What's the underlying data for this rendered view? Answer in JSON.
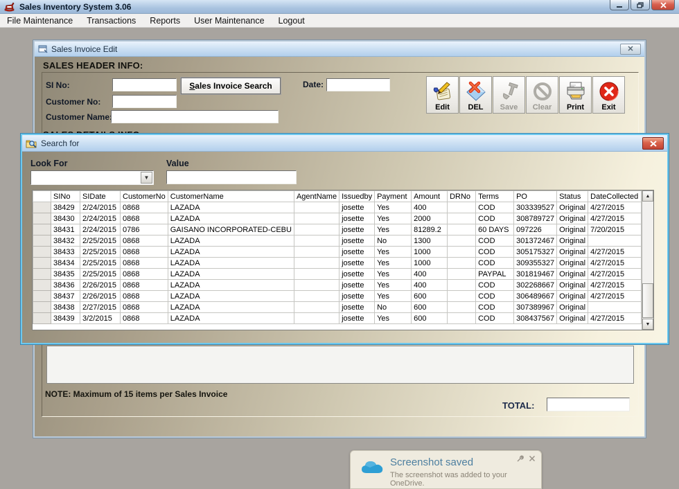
{
  "window": {
    "title": "Sales Inventory System 3.06",
    "menu": [
      "File Maintenance",
      "Transactions",
      "Reports",
      "User Maintenance",
      "Logout"
    ]
  },
  "invoice_dialog": {
    "title": "Sales Invoice Edit",
    "header_section_label": "SALES HEADER INFO:",
    "details_section_label": "SALES DETAILS INFO",
    "fields": {
      "si_no_label": "SI No:",
      "customer_no_label": "Customer No:",
      "customer_name_label": "Customer Name:",
      "date_label": "Date:",
      "si_no_value": "",
      "customer_no_value": "",
      "customer_name_value": "",
      "date_value": ""
    },
    "search_button_label": "Sales Invoice Search",
    "toolbar": [
      {
        "label": "Edit",
        "enabled": true
      },
      {
        "label": "DEL",
        "enabled": true
      },
      {
        "label": "Save",
        "enabled": false
      },
      {
        "label": "Clear",
        "enabled": false
      },
      {
        "label": "Print",
        "enabled": true
      },
      {
        "label": "Exit",
        "enabled": true
      }
    ],
    "note": "NOTE: Maximum of 15 items per Sales Invoice",
    "total_label": "TOTAL:",
    "total_value": ""
  },
  "search_dialog": {
    "title": "Search for",
    "look_for_label": "Look For",
    "look_for_value": "",
    "value_label": "Value",
    "value_value": "",
    "table": {
      "columns": [
        "SINo",
        "SIDate",
        "CustomerNo",
        "CustomerName",
        "AgentName",
        "Issuedby",
        "Payment",
        "Amount",
        "DRNo",
        "Terms",
        "PO",
        "Status",
        "DateCollected"
      ],
      "rows": [
        [
          "38429",
          "2/24/2015",
          "0868",
          "LAZADA",
          "",
          "josette",
          "Yes",
          "400",
          "",
          "COD",
          "303339527",
          "Original",
          "4/27/2015"
        ],
        [
          "38430",
          "2/24/2015",
          "0868",
          "LAZADA",
          "",
          "josette",
          "Yes",
          "2000",
          "",
          "COD",
          "308789727",
          "Original",
          "4/27/2015"
        ],
        [
          "38431",
          "2/24/2015",
          "0786",
          "GAISANO INCORPORATED-CEBU",
          "",
          "josette",
          "Yes",
          "81289.2",
          "",
          "60 DAYS",
          "097226",
          "Original",
          "7/20/2015"
        ],
        [
          "38432",
          "2/25/2015",
          "0868",
          "LAZADA",
          "",
          "josette",
          "No",
          "1300",
          "",
          "COD",
          "301372467",
          "Original",
          ""
        ],
        [
          "38433",
          "2/25/2015",
          "0868",
          "LAZADA",
          "",
          "josette",
          "Yes",
          "1000",
          "",
          "COD",
          "305175327",
          "Original",
          "4/27/2015"
        ],
        [
          "38434",
          "2/25/2015",
          "0868",
          "LAZADA",
          "",
          "josette",
          "Yes",
          "1000",
          "",
          "COD",
          "309355327",
          "Original",
          "4/27/2015"
        ],
        [
          "38435",
          "2/25/2015",
          "0868",
          "LAZADA",
          "",
          "josette",
          "Yes",
          "400",
          "",
          "PAYPAL",
          "301819467",
          "Original",
          "4/27/2015"
        ],
        [
          "38436",
          "2/26/2015",
          "0868",
          "LAZADA",
          "",
          "josette",
          "Yes",
          "400",
          "",
          "COD",
          "302268667",
          "Original",
          "4/27/2015"
        ],
        [
          "38437",
          "2/26/2015",
          "0868",
          "LAZADA",
          "",
          "josette",
          "Yes",
          "600",
          "",
          "COD",
          "306489667",
          "Original",
          "4/27/2015"
        ],
        [
          "38438",
          "2/27/2015",
          "0868",
          "LAZADA",
          "",
          "josette",
          "No",
          "600",
          "",
          "COD",
          "307389967",
          "Original",
          ""
        ],
        [
          "38439",
          "3/2/2015",
          "0868",
          "LAZADA",
          "",
          "josette",
          "Yes",
          "600",
          "",
          "COD",
          "308437567",
          "Original",
          "4/27/2015"
        ]
      ]
    }
  },
  "toast": {
    "title": "Screenshot saved",
    "message": "The screenshot was added to your OneDrive."
  },
  "colors": {
    "accent_red": "#d02818",
    "titlebar_blue": "#aac4e0",
    "dialog_tan_dark": "#8f8877",
    "dialog_tan_light": "#f8f4e4"
  }
}
